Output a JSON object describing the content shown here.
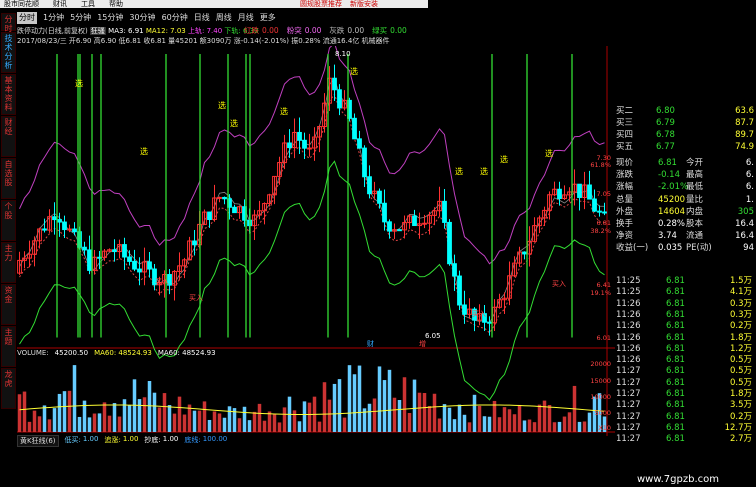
{
  "menubar": {
    "items": [
      "股市同花顺",
      "财讯",
      "工具",
      "帮助"
    ]
  },
  "redbar": {
    "items": [
      "圆规股票推荐",
      "新版安装"
    ]
  },
  "left_tabs": [
    "分时",
    "技术分析",
    "基本资料",
    "财经",
    "自选股",
    "个股",
    "主力",
    "资金",
    "主题",
    "龙虎"
  ],
  "periods": {
    "items": [
      "分时",
      "1分钟",
      "5分钟",
      "15分钟",
      "30分钟",
      "60分钟",
      "日线",
      "周线",
      "月线",
      "更多"
    ],
    "active_index": 0
  },
  "status": {
    "items": [
      {
        "label": "红跌",
        "value": "0.00",
        "color": "#e33"
      },
      {
        "label": "粉突",
        "value": "0.00",
        "color": "#e6e"
      },
      {
        "label": "灰跌",
        "value": "0.00",
        "color": "#bbb"
      },
      {
        "label": "绿买",
        "value": "0.00",
        "color": "#3d3"
      }
    ]
  },
  "infoline1": {
    "title": "跌停动力(日线,前复权)",
    "tag": "狂骚",
    "ma3": "MA3: 6.91",
    "ma12": "MA12: 7.03",
    "up_label": "上轨: 7.40",
    "down_label": "下轨: 6.30"
  },
  "infoline2": {
    "text": "2017/08/23/三 开6.90 高6.90 低6.81 收6.81 量45201 额3090万 涨-0.14(-2.01%) 振0.28% 流通16.4亿 机械器件"
  },
  "signal_label": "选",
  "chart_labels": {
    "top_price": "8.10",
    "low_price": "6.05",
    "buy": "买入",
    "mark_bottom": "财",
    "mark_bottom2": "增"
  },
  "price_axis": {
    "ticks": [
      "7.30",
      "61.8%",
      "7.05",
      "6.81",
      "38.2%",
      "6.41",
      "19.1%",
      "6.01"
    ]
  },
  "volume": {
    "label": "VOLUME:",
    "value": "45200.50",
    "ma60a": "MA60: 48524.93",
    "ma60b": "MA60: 48524.93",
    "ticks": [
      "20000",
      "15000",
      "10000",
      "5000",
      "X10"
    ]
  },
  "indicator": {
    "name": "黄K狂线(6)",
    "items": [
      {
        "label": "低买:",
        "value": "1.00",
        "color": "#6cf"
      },
      {
        "label": "追涨:",
        "value": "1.00",
        "color": "#ff3"
      },
      {
        "label": "抄底:",
        "value": "1.00",
        "color": "#fff"
      },
      {
        "label": "底线:",
        "value": "100.00",
        "color": "#39f"
      }
    ]
  },
  "quote": {
    "bids": [
      {
        "label": "买二",
        "price": "6.80",
        "vol": "63.6"
      },
      {
        "label": "买三",
        "price": "6.79",
        "vol": "87.7"
      },
      {
        "label": "买四",
        "price": "6.78",
        "vol": "89.7"
      },
      {
        "label": "买五",
        "price": "6.77",
        "vol": "74.9"
      }
    ],
    "stats": [
      {
        "l1": "现价",
        "v1": "6.81",
        "l2": "今开",
        "v2": "6."
      },
      {
        "l1": "涨跌",
        "v1": "-0.14",
        "l2": "最高",
        "v2": "6."
      },
      {
        "l1": "涨幅",
        "v1": "-2.01%",
        "l2": "最低",
        "v2": "6."
      },
      {
        "l1": "总量",
        "v1": "45200",
        "l2": "量比",
        "v2": "1."
      },
      {
        "l1": "外盘",
        "v1": "14604",
        "l2": "内盘",
        "v2": "305"
      },
      {
        "l1": "换手",
        "v1": "0.28%",
        "l2": "股本",
        "v2": "16.4"
      },
      {
        "l1": "净资",
        "v1": "3.74",
        "l2": "流通",
        "v2": "16.4"
      },
      {
        "l1": "收益(一)",
        "v1": "0.035",
        "l2": "PE(动)",
        "v2": "94"
      }
    ],
    "ticks": [
      {
        "t": "11:25",
        "p": "6.81",
        "v": "1.5万"
      },
      {
        "t": "11:25",
        "p": "6.81",
        "v": "4.1万"
      },
      {
        "t": "11:26",
        "p": "6.81",
        "v": "0.3万"
      },
      {
        "t": "11:26",
        "p": "6.81",
        "v": "0.3万"
      },
      {
        "t": "11:26",
        "p": "6.81",
        "v": "0.2万"
      },
      {
        "t": "11:26",
        "p": "6.81",
        "v": "1.8万"
      },
      {
        "t": "11:26",
        "p": "6.81",
        "v": "1.2万"
      },
      {
        "t": "11:26",
        "p": "6.81",
        "v": "0.5万"
      },
      {
        "t": "11:27",
        "p": "6.81",
        "v": "0.5万"
      },
      {
        "t": "11:27",
        "p": "6.81",
        "v": "0.5万"
      },
      {
        "t": "11:27",
        "p": "6.81",
        "v": "1.8万"
      },
      {
        "t": "11:27",
        "p": "6.81",
        "v": "3.5万"
      },
      {
        "t": "11:27",
        "p": "6.81",
        "v": "0.2万"
      },
      {
        "t": "11:27",
        "p": "6.81",
        "v": "12.7万"
      },
      {
        "t": "11:27",
        "p": "6.81",
        "v": "2.7万"
      }
    ]
  },
  "watermark": "www.7gpzb.com",
  "colors": {
    "up": "#ff3232",
    "down": "#00ffff",
    "green": "#33dd33",
    "magenta": "#c040c0",
    "yellow": "#ffff00",
    "blue": "#3388ff"
  }
}
